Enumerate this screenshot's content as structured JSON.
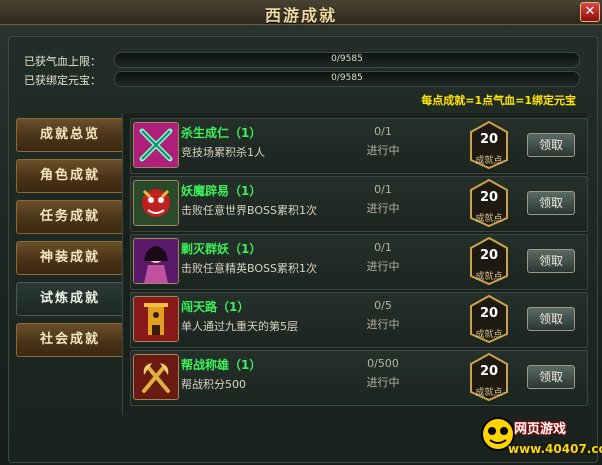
{
  "window": {
    "title": "西游成就",
    "close_label": "✕"
  },
  "progress": [
    {
      "label": "已获气血上限：",
      "value": "0/9585",
      "fraction": 0
    },
    {
      "label": "已获绑定元宝：",
      "value": "0/9585",
      "fraction": 0
    }
  ],
  "rate_note": "每点成就=1点气血=1绑定元宝",
  "sidebar": {
    "items": [
      {
        "label": "成就总览",
        "active": false
      },
      {
        "label": "角色成就",
        "active": false
      },
      {
        "label": "任务成就",
        "active": false
      },
      {
        "label": "神装成就",
        "active": false
      },
      {
        "label": "试炼成就",
        "active": true
      },
      {
        "label": "社会成就",
        "active": false
      }
    ]
  },
  "achievements": [
    {
      "name": "杀生成仁（1）",
      "desc": "竞技场累积杀1人",
      "progress": "0/1",
      "status": "进行中",
      "points": "20",
      "points_label": "成就点",
      "claim_label": "领取",
      "icon": "crossed-swords-icon"
    },
    {
      "name": "妖魔辟易（1）",
      "desc": "击败任意世界BOSS累积1次",
      "progress": "0/1",
      "status": "进行中",
      "points": "20",
      "points_label": "成就点",
      "claim_label": "领取",
      "icon": "demon-icon"
    },
    {
      "name": "剿灭群妖（1）",
      "desc": "击败任意精英BOSS累积1次",
      "progress": "0/1",
      "status": "进行中",
      "points": "20",
      "points_label": "成就点",
      "claim_label": "领取",
      "icon": "lady-icon"
    },
    {
      "name": "闯天路（1）",
      "desc": "单人通过九重天的第5层",
      "progress": "0/5",
      "status": "进行中",
      "points": "20",
      "points_label": "成就点",
      "claim_label": "领取",
      "icon": "tower-icon"
    },
    {
      "name": "帮战称雄（1）",
      "desc": "帮战积分500",
      "progress": "0/500",
      "status": "进行中",
      "points": "20",
      "points_label": "成就点",
      "claim_label": "领取",
      "icon": "axes-icon"
    }
  ],
  "watermark": {
    "line1": "网页游戏",
    "line2": "www.40407.com"
  },
  "colors": {
    "accent_green": "#3cf05a",
    "note_yellow": "#ffe400",
    "title_gold": "#f0d9a0"
  }
}
